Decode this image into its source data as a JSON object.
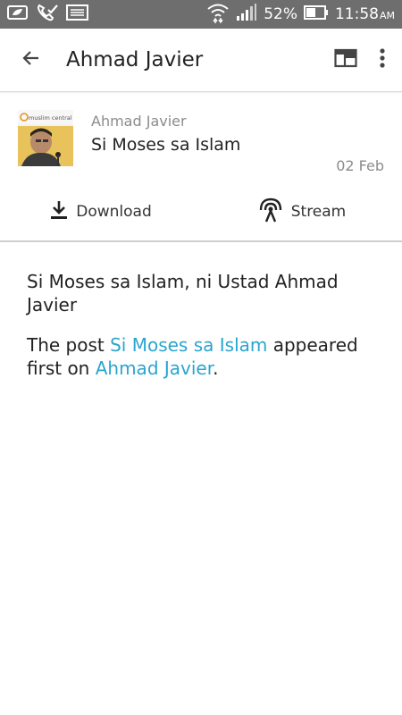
{
  "status_bar": {
    "battery_percent": "52%",
    "time": "11:58",
    "ampm": "AM",
    "icons": [
      "leaf-icon",
      "phone-check-icon",
      "keyboard-icon",
      "wifi-icon",
      "signal-icon",
      "battery-icon"
    ]
  },
  "app_bar": {
    "title": "Ahmad Javier",
    "icons": [
      "back-arrow-icon",
      "web-view-icon",
      "more-vert-icon"
    ]
  },
  "episode": {
    "thumbnail_logo_text": "muslim central",
    "author": "Ahmad Javier",
    "title": "Si Moses sa Islam",
    "date": "02 Feb"
  },
  "actions": {
    "download_label": "Download",
    "stream_label": "Stream"
  },
  "description": {
    "line1": "Si Moses sa Islam, ni Ustad Ahmad Javier",
    "post_prefix": "The post ",
    "post_link": "Si Moses sa Islam",
    "post_middle": " appeared first on ",
    "site_link": "Ahmad Javier",
    "post_suffix": "."
  },
  "colors": {
    "status_bar": "#6e6e6e",
    "link": "#2aa5cf",
    "muted_text": "#8c8c8c"
  }
}
